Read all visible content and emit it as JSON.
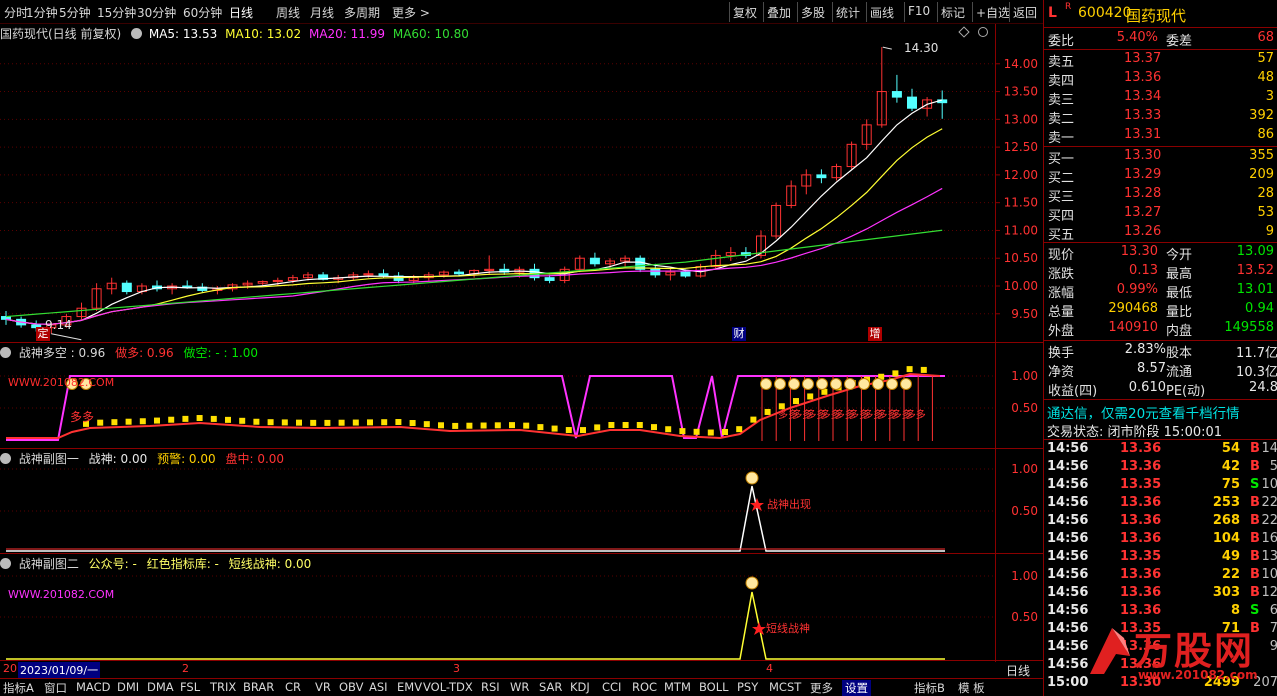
{
  "topbar": {
    "periods": [
      "分时",
      "1分钟",
      "5分钟",
      "15分钟",
      "30分钟",
      "60分钟",
      "日线",
      "周线",
      "月线",
      "多周期",
      "更多 >"
    ],
    "active_period": "日线",
    "buttons": [
      "复权",
      "叠加",
      "多股",
      "统计",
      "画线",
      "F10",
      "标记",
      "+自选",
      "返回"
    ]
  },
  "main_panel": {
    "title": "国药现代(日线 前复权)",
    "ma": [
      {
        "label": "MA5: 13.53",
        "color": "#ffffff"
      },
      {
        "label": "MA10: 13.02",
        "color": "#ffff33"
      },
      {
        "label": "MA20: 11.99",
        "color": "#ff33ff"
      },
      {
        "label": "MA60: 10.80",
        "color": "#33dd33"
      }
    ],
    "price_axis": [
      "14.00",
      "13.50",
      "13.00",
      "12.50",
      "12.00",
      "11.50",
      "11.00",
      "10.50",
      "10.00",
      "9.50"
    ],
    "high_label": "14.30",
    "low_label": "9.14",
    "markers": {
      "ding": "定",
      "cai": "财",
      "zeng": "增"
    }
  },
  "panel2": {
    "title": "战神多空 : 0.96",
    "item2": "做多: 0.96",
    "item3": "做空: - : 1.00",
    "watermark": "WWW.201082.COM",
    "label_duoduo": "多多",
    "axis": [
      "1.00",
      "0.50"
    ]
  },
  "panel3": {
    "title": "战神副图一",
    "item1": "战神: 0.00",
    "item2": "预警: 0.00",
    "item3": "盘中: 0.00",
    "signal_text": "战神出现",
    "axis": [
      "1.00",
      "0.50"
    ]
  },
  "panel4": {
    "title": "战神副图二",
    "item1": "公众号: -",
    "item2": "红色指标库: -",
    "item3": "短线战神: 0.00",
    "watermark": "WWW.201082.COM",
    "signal_text": "短线战神",
    "axis": [
      "1.00",
      "0.50"
    ]
  },
  "x_axis": {
    "date": "2023/01/09/一",
    "left": "20",
    "m2": "2",
    "m3": "3",
    "m4": "4",
    "period_label": "日线"
  },
  "bottom_tabs": [
    "指标A",
    "窗口",
    "MACD",
    "DMI",
    "DMA",
    "FSL",
    "TRIX",
    "BRAR",
    "CR",
    "VR",
    "OBV",
    "ASI",
    "EMV",
    "VOL-TDX",
    "RSI",
    "WR",
    "SAR",
    "KDJ",
    "CCI",
    "ROC",
    "MTM",
    "BOLL",
    "PSY",
    "MCST",
    "更多",
    "设置",
    "指标B",
    "模 板"
  ],
  "sidebar": {
    "code": "600420",
    "name": "国药现代",
    "l_label": "L",
    "r_label": "R",
    "weibi_label": "委比",
    "weibi_value": "5.40%",
    "weicha_label": "委差",
    "weicha_value": "68",
    "asks": [
      {
        "label": "卖五",
        "price": "13.37",
        "vol": "57"
      },
      {
        "label": "卖四",
        "price": "13.36",
        "vol": "48"
      },
      {
        "label": "卖三",
        "price": "13.34",
        "vol": "3"
      },
      {
        "label": "卖二",
        "price": "13.33",
        "vol": "392"
      },
      {
        "label": "卖一",
        "price": "13.31",
        "vol": "86"
      }
    ],
    "bids": [
      {
        "label": "买一",
        "price": "13.30",
        "vol": "355"
      },
      {
        "label": "买二",
        "price": "13.29",
        "vol": "209"
      },
      {
        "label": "买三",
        "price": "13.28",
        "vol": "28"
      },
      {
        "label": "买四",
        "price": "13.27",
        "vol": "53"
      },
      {
        "label": "买五",
        "price": "13.26",
        "vol": "9"
      }
    ],
    "stats": [
      {
        "l1": "现价",
        "v1": "13.30",
        "l2": "今开",
        "v2": "13.09",
        "c1": "#ff3232",
        "c2": "#00e600"
      },
      {
        "l1": "涨跌",
        "v1": "0.13",
        "l2": "最高",
        "v2": "13.52",
        "c1": "#ff3232",
        "c2": "#ff3232"
      },
      {
        "l1": "涨幅",
        "v1": "0.99%",
        "l2": "最低",
        "v2": "13.01",
        "c1": "#ff3232",
        "c2": "#00e600"
      },
      {
        "l1": "总量",
        "v1": "290468",
        "l2": "量比",
        "v2": "0.94",
        "c1": "#ffd000",
        "c2": "#00e600"
      },
      {
        "l1": "外盘",
        "v1": "140910",
        "l2": "内盘",
        "v2": "149558",
        "c1": "#ff3232",
        "c2": "#00e600"
      }
    ],
    "stats2": [
      {
        "l1": "换手",
        "v1": "2.83%",
        "l2": "股本",
        "v2": "11.7亿"
      },
      {
        "l1": "净资",
        "v1": "8.57",
        "l2": "流通",
        "v2": "10.3亿"
      },
      {
        "l1": "收益(四)",
        "v1": "0.610",
        "l2": "PE(动)",
        "v2": "24.8"
      }
    ],
    "promo": "通达信，仅需20元查看千档行情",
    "status": "交易状态: 闭市阶段 15:00:01",
    "ticks": [
      {
        "t": "14:56",
        "p": "13.36",
        "v": "54",
        "d": "B",
        "n": "14"
      },
      {
        "t": "14:56",
        "p": "13.36",
        "v": "42",
        "d": "B",
        "n": "5"
      },
      {
        "t": "14:56",
        "p": "13.35",
        "v": "75",
        "d": "S",
        "n": "10"
      },
      {
        "t": "14:56",
        "p": "13.36",
        "v": "253",
        "d": "B",
        "n": "22"
      },
      {
        "t": "14:56",
        "p": "13.36",
        "v": "268",
        "d": "B",
        "n": "22"
      },
      {
        "t": "14:56",
        "p": "13.36",
        "v": "104",
        "d": "B",
        "n": "16"
      },
      {
        "t": "14:56",
        "p": "13.35",
        "v": "49",
        "d": "B",
        "n": "13"
      },
      {
        "t": "14:56",
        "p": "13.36",
        "v": "22",
        "d": "B",
        "n": "10"
      },
      {
        "t": "14:56",
        "p": "13.36",
        "v": "303",
        "d": "B",
        "n": "12"
      },
      {
        "t": "14:56",
        "p": "13.36",
        "v": "8",
        "d": "S",
        "n": "6"
      },
      {
        "t": "14:56",
        "p": "13.35",
        "v": "71",
        "d": "B",
        "n": "7"
      },
      {
        "t": "14:56",
        "p": "13.36",
        "v": "",
        "d": "",
        "n": "9"
      },
      {
        "t": "14:56",
        "p": "13.36",
        "v": "",
        "d": "",
        "n": ""
      },
      {
        "t": "15:00",
        "p": "13.30",
        "v": "2499",
        "d": "",
        "n": "207"
      }
    ],
    "logo_text": "万股网",
    "logo_url": "www.201082.com"
  },
  "chart_data": {
    "type": "candlestick",
    "title": "国药现代(日线 前复权)",
    "ylim": [
      9.1,
      14.5
    ],
    "candles": [
      [
        9.45,
        9.55,
        9.3,
        9.4
      ],
      [
        9.4,
        9.45,
        9.25,
        9.3
      ],
      [
        9.3,
        9.38,
        9.18,
        9.25
      ],
      [
        9.25,
        9.35,
        9.14,
        9.3
      ],
      [
        9.3,
        9.5,
        9.25,
        9.45
      ],
      [
        9.45,
        9.7,
        9.4,
        9.6
      ],
      [
        9.6,
        10.05,
        9.55,
        9.95
      ],
      [
        9.95,
        10.15,
        9.85,
        10.05
      ],
      [
        10.05,
        10.1,
        9.85,
        9.9
      ],
      [
        9.9,
        10.05,
        9.85,
        10.0
      ],
      [
        10.0,
        10.1,
        9.9,
        9.95
      ],
      [
        9.95,
        10.05,
        9.85,
        10.0
      ],
      [
        10.0,
        10.1,
        9.95,
        9.98
      ],
      [
        9.98,
        10.05,
        9.88,
        9.92
      ],
      [
        9.92,
        10.0,
        9.85,
        9.95
      ],
      [
        9.95,
        10.05,
        9.9,
        10.02
      ],
      [
        10.02,
        10.1,
        9.95,
        10.05
      ],
      [
        10.05,
        10.1,
        10.0,
        10.08
      ],
      [
        10.08,
        10.15,
        10.0,
        10.1
      ],
      [
        10.1,
        10.2,
        10.05,
        10.15
      ],
      [
        10.15,
        10.25,
        10.1,
        10.2
      ],
      [
        10.2,
        10.25,
        10.1,
        10.12
      ],
      [
        10.12,
        10.2,
        10.05,
        10.15
      ],
      [
        10.15,
        10.25,
        10.1,
        10.2
      ],
      [
        10.2,
        10.28,
        10.15,
        10.22
      ],
      [
        10.22,
        10.3,
        10.15,
        10.18
      ],
      [
        10.18,
        10.25,
        10.05,
        10.1
      ],
      [
        10.1,
        10.2,
        10.05,
        10.15
      ],
      [
        10.15,
        10.25,
        10.1,
        10.2
      ],
      [
        10.2,
        10.28,
        10.15,
        10.25
      ],
      [
        10.25,
        10.3,
        10.18,
        10.22
      ],
      [
        10.22,
        10.3,
        10.15,
        10.28
      ],
      [
        10.28,
        10.55,
        10.2,
        10.3
      ],
      [
        10.3,
        10.4,
        10.2,
        10.25
      ],
      [
        10.25,
        10.35,
        10.15,
        10.3
      ],
      [
        10.3,
        10.4,
        10.1,
        10.15
      ],
      [
        10.15,
        10.2,
        10.05,
        10.1
      ],
      [
        10.1,
        10.35,
        10.05,
        10.3
      ],
      [
        10.3,
        10.55,
        10.25,
        10.5
      ],
      [
        10.5,
        10.6,
        10.35,
        10.4
      ],
      [
        10.4,
        10.5,
        10.3,
        10.45
      ],
      [
        10.45,
        10.55,
        10.35,
        10.5
      ],
      [
        10.5,
        10.55,
        10.25,
        10.3
      ],
      [
        10.3,
        10.4,
        10.15,
        10.2
      ],
      [
        10.2,
        10.35,
        10.1,
        10.25
      ],
      [
        10.25,
        10.3,
        10.15,
        10.18
      ],
      [
        10.18,
        10.4,
        10.15,
        10.35
      ],
      [
        10.35,
        10.65,
        10.3,
        10.55
      ],
      [
        10.55,
        10.7,
        10.45,
        10.6
      ],
      [
        10.6,
        10.7,
        10.5,
        10.55
      ],
      [
        10.55,
        11.0,
        10.5,
        10.9
      ],
      [
        10.9,
        11.5,
        10.85,
        11.45
      ],
      [
        11.45,
        11.9,
        11.4,
        11.8
      ],
      [
        11.8,
        12.1,
        11.65,
        12.0
      ],
      [
        12.0,
        12.1,
        11.85,
        11.95
      ],
      [
        11.95,
        12.2,
        11.9,
        12.15
      ],
      [
        12.15,
        12.6,
        12.1,
        12.55
      ],
      [
        12.55,
        13.0,
        12.45,
        12.9
      ],
      [
        12.9,
        14.3,
        12.85,
        13.5
      ],
      [
        13.5,
        13.8,
        13.3,
        13.4
      ],
      [
        13.4,
        13.55,
        13.15,
        13.2
      ],
      [
        13.2,
        13.4,
        13.05,
        13.35
      ],
      [
        13.35,
        13.52,
        13.01,
        13.3
      ]
    ]
  }
}
